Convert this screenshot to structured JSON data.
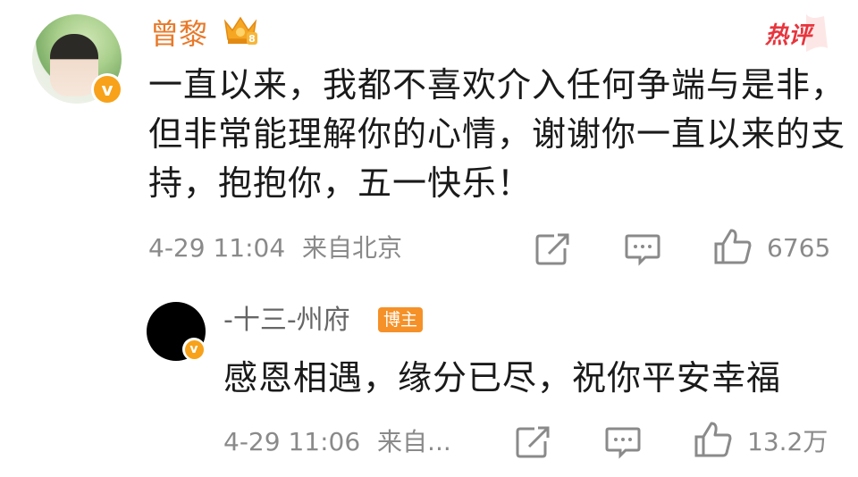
{
  "comment": {
    "author": "曾黎",
    "hot_label": "热评",
    "text": "一直以来，我都不喜欢介入任何争端与是非，但非常能理解你的心情，谢谢你一直以来的支持，抱抱你，五一快乐！",
    "time": "4-29 11:04",
    "location": "来自北京",
    "likes": "6765",
    "verified_badge": "v",
    "crown_level": "8"
  },
  "reply": {
    "author": "-十三-州府",
    "author_badge": "博主",
    "text": "感恩相遇，缘分已尽，祝你平安幸福",
    "time": "4-29 11:06",
    "location": "来自...",
    "likes": "13.2万",
    "verified_badge": "v"
  },
  "colors": {
    "author_name": "#e8792a",
    "meta": "#8a8a8a",
    "body": "#1a1a1a",
    "hot": "#e8353d",
    "badge": "#f59128"
  },
  "icons": [
    "crown-icon",
    "hot-comment-icon",
    "share-icon",
    "comment-icon",
    "like-icon",
    "verified-icon"
  ]
}
